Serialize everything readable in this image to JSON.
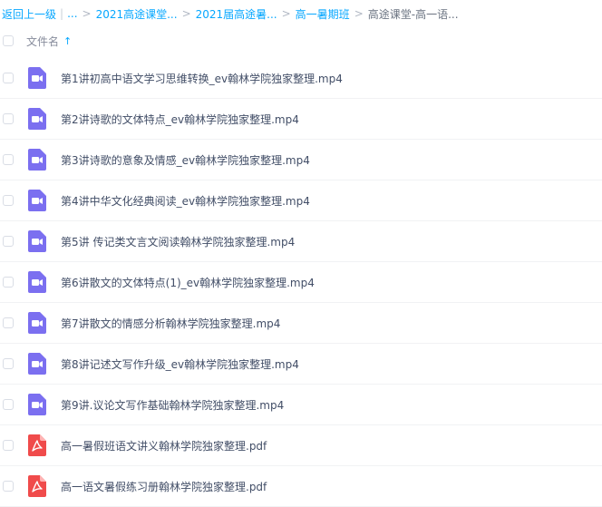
{
  "breadcrumb": {
    "back": "返回上一级",
    "ellipsis": "...",
    "crumbs": [
      "2021高途课堂...",
      "2021届高途暑...",
      "高一暑期班"
    ],
    "current": "高途课堂-高一语..."
  },
  "header": {
    "column_label": "文件名",
    "sort_icon": "arrow-up-icon"
  },
  "colors": {
    "link": "#06a7ff",
    "video_icon": "#7b6ff0",
    "pdf_icon": "#f04b4b"
  },
  "files": [
    {
      "name": "第1讲初高中语文学习思维转换_ev翰林学院独家整理.mp4",
      "icon": "video-file-icon"
    },
    {
      "name": "第2讲诗歌的文体特点_ev翰林学院独家整理.mp4",
      "icon": "video-file-icon"
    },
    {
      "name": "第3讲诗歌的意象及情感_ev翰林学院独家整理.mp4",
      "icon": "video-file-icon"
    },
    {
      "name": "第4讲中华文化经典阅读_ev翰林学院独家整理.mp4",
      "icon": "video-file-icon"
    },
    {
      "name": "第5讲 传记类文言文阅读翰林学院独家整理.mp4",
      "icon": "video-file-icon"
    },
    {
      "name": "第6讲散文的文体特点(1)_ev翰林学院独家整理.mp4",
      "icon": "video-file-icon"
    },
    {
      "name": "第7讲散文的情感分析翰林学院独家整理.mp4",
      "icon": "video-file-icon"
    },
    {
      "name": "第8讲记述文写作升级_ev翰林学院独家整理.mp4",
      "icon": "video-file-icon"
    },
    {
      "name": "第9讲.议论文写作基础翰林学院独家整理.mp4",
      "icon": "video-file-icon"
    },
    {
      "name": "高一暑假班语文讲义翰林学院独家整理.pdf",
      "icon": "pdf-file-icon"
    },
    {
      "name": "高一语文暑假练习册翰林学院独家整理.pdf",
      "icon": "pdf-file-icon"
    }
  ]
}
